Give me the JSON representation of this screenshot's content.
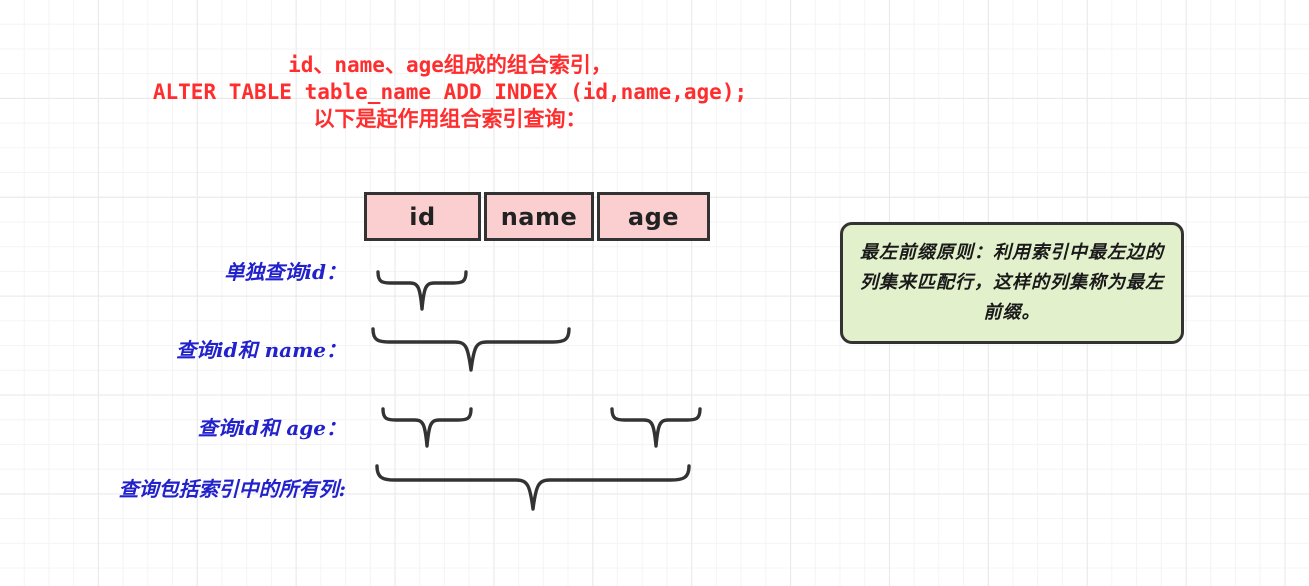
{
  "heading": {
    "line1": "id、name、age组成的组合索引，",
    "line2": "ALTER TABLE table_name ADD INDEX (id,name,age);",
    "line3": "以下是起作用组合索引查询："
  },
  "index_columns": [
    {
      "name": "id",
      "label": "id"
    },
    {
      "name": "name",
      "label": "name"
    },
    {
      "name": "age",
      "label": "age"
    }
  ],
  "query_rows": [
    {
      "label": "单独查询id：",
      "covers": [
        "id"
      ]
    },
    {
      "label": "查询id和 name：",
      "covers": [
        "id",
        "name"
      ]
    },
    {
      "label": "查询id和 age：",
      "covers": [
        "id",
        "age"
      ]
    },
    {
      "label": "查询包括索引中的所有列:",
      "covers": [
        "id",
        "name",
        "age"
      ]
    }
  ],
  "note": {
    "text": "最左前缀原则：利用索引中最左边的列集来匹配行，这样的列集称为最左前缀。"
  },
  "colors": {
    "heading_red": "#ff2d2d",
    "label_blue": "#2222cc",
    "box_pink": "#fbcfcf",
    "note_green": "#e2f0cb",
    "stroke_dark": "#333333",
    "grid_minor": "#f4f4f4",
    "grid_major": "#e9e9e9"
  }
}
